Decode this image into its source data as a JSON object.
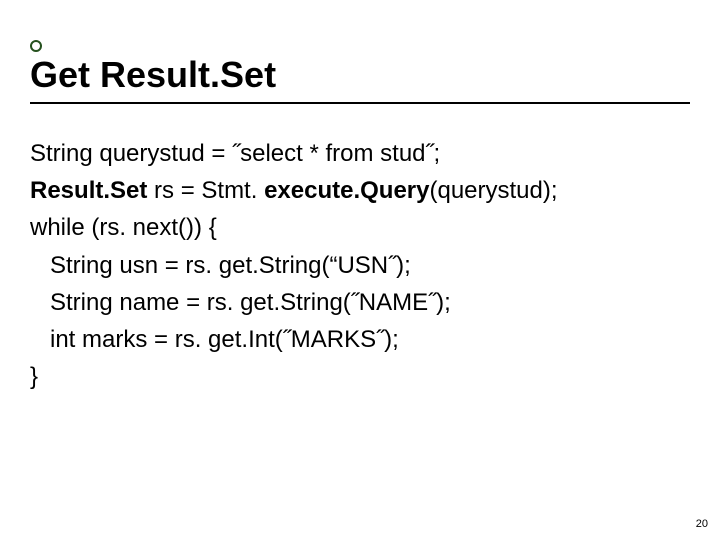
{
  "title": "Get Result.Set",
  "code": {
    "line1_a": "String querystud = ˝select * from stud˝;",
    "line2_a": "Result.Set",
    "line2_b": " rs = Stmt. ",
    "line2_c": "execute.Query",
    "line2_d": "(querystud);",
    "line3": "while (rs. next()) {",
    "line4": "   String usn = rs. get.String(“USN˝);",
    "line5": "   String name = rs. get.String(˝NAME˝);",
    "line6": "   int marks = rs. get.Int(˝MARKS˝);",
    "line7": "}"
  },
  "page_number": "20"
}
